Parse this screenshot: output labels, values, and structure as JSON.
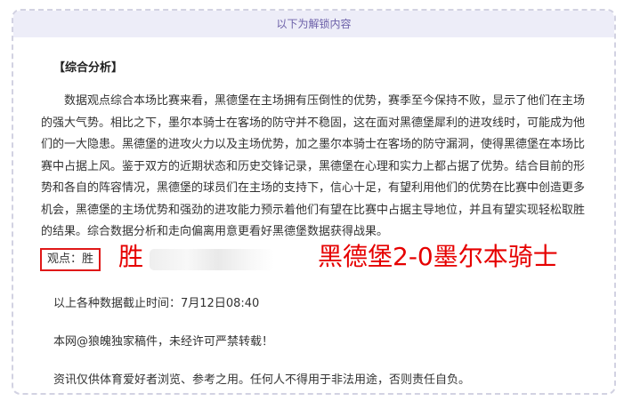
{
  "card": {
    "header": "以下为解锁内容",
    "section_title": "【综合分析】",
    "analysis": "数据观点综合本场比赛来看，黑德堡在主场拥有压倒性的优势，赛季至今保持不败，显示了他们在主场的强大气势。相比之下，墨尔本骑士在客场的防守并不稳固，这在面对黑德堡犀利的进攻线时，可能成为他们的一大隐患。黑德堡的进攻火力以及主场优势，加之墨尔本骑士在客场的防守漏洞，使得黑德堡在本场比赛中占据上风。鉴于双方的近期状态和历史交锋记录，黑德堡在心理和实力上都占据了优势。结合目前的形势和各自的阵容情况，黑德堡的球员们在主场的支持下，信心十足，有望利用他们的优势在比赛中创造更多机会，黑德堡的主场优势和强劲的进攻能力预示着他们有望在比赛中占据主导地位，并且有望实现轻松取胜的结果。综合数据分析和走向偏离用意更看好黑德堡数据获得战果。",
    "opinion_label": "观点：胜",
    "opinion_result": "胜",
    "score_prediction": "黑德堡2-0墨尔本骑士",
    "data_time": "以上各种数据截止时间：7月12日08:40",
    "copyright": "本网@狼魄独家稿件，未经许可严禁转载！",
    "disclaimer": "资讯仅供体育爱好者浏览、参考之用。任何人不得用于非法用途，否则责任自负。"
  },
  "colors": {
    "header_bg": "#ededf8",
    "header_text": "#6b5fa8",
    "accent_red": "#e60000",
    "card_border": "#d2d2e2"
  }
}
